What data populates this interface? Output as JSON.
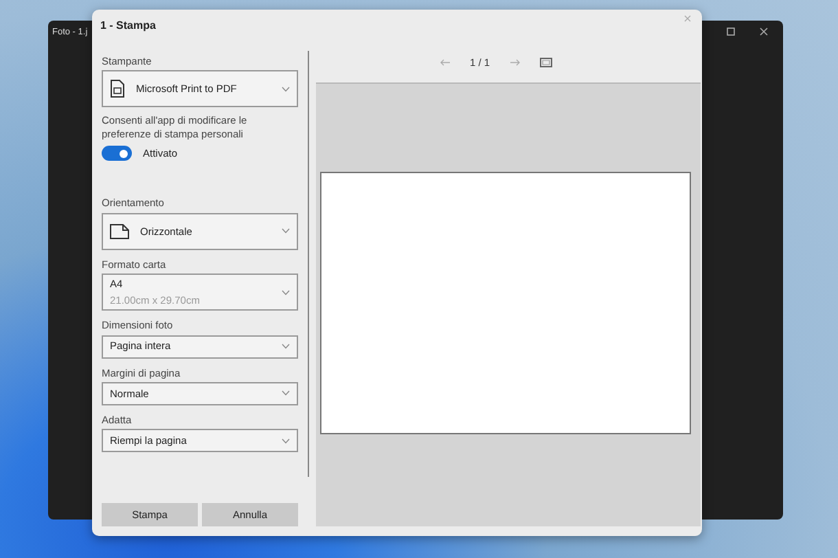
{
  "app_window": {
    "title": "Foto - 1.j"
  },
  "dialog": {
    "title": "1 - Stampa"
  },
  "settings": [
    {
      "kind": "printer-select",
      "label": "Stampante",
      "value": "Microsoft Print to PDF"
    },
    {
      "kind": "toggle",
      "label": "Consenti all'app di modificare le preferenze di stampa personali",
      "on": true,
      "state_label": "Attivato"
    },
    {
      "kind": "orientation-select",
      "label": "Orientamento",
      "value": "Orizzontale"
    },
    {
      "kind": "select",
      "label": "Formato carta",
      "value": "A4",
      "detail": "21.00cm x 29.70cm"
    },
    {
      "kind": "select",
      "label": "Dimensioni foto",
      "value": "Pagina intera"
    },
    {
      "kind": "select",
      "label": "Margini di pagina",
      "value": "Normale"
    },
    {
      "kind": "select",
      "label": "Adatta",
      "value": "Riempi la pagina"
    }
  ],
  "preview": {
    "page_counter": "1 / 1"
  },
  "buttons": [
    "Stampa",
    "Annulla"
  ]
}
